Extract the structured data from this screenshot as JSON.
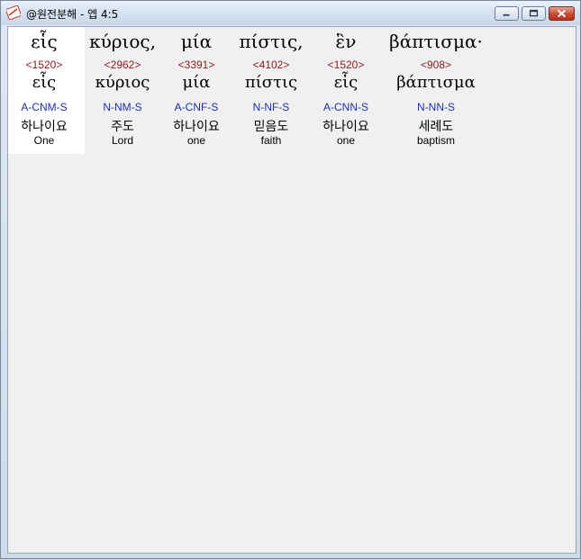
{
  "window": {
    "title": "@원전분해 - 엡 4:5"
  },
  "words": [
    {
      "original": "εἷς",
      "strong": "<1520>",
      "lemma": "εἷς",
      "morph": "A-CNM-S",
      "korean": "하나이요",
      "english": "One"
    },
    {
      "original": "κύριος,",
      "strong": "<2962>",
      "lemma": "κύριος",
      "morph": "N-NM-S",
      "korean": "주도",
      "english": "Lord"
    },
    {
      "original": "μία",
      "strong": "<3391>",
      "lemma": "μία",
      "morph": "A-CNF-S",
      "korean": "하나이요",
      "english": "one"
    },
    {
      "original": "πίστις,",
      "strong": "<4102>",
      "lemma": "πίστις",
      "morph": "N-NF-S",
      "korean": "믿음도",
      "english": "faith"
    },
    {
      "original": "ἓν",
      "strong": "<1520>",
      "lemma": "εἷς",
      "morph": "A-CNN-S",
      "korean": "하나이요",
      "english": "one"
    },
    {
      "original": "βάπτισμα·",
      "strong": "<908>",
      "lemma": "βάπτισμα",
      "morph": "N-NN-S",
      "korean": "세례도",
      "english": "baptism"
    }
  ]
}
